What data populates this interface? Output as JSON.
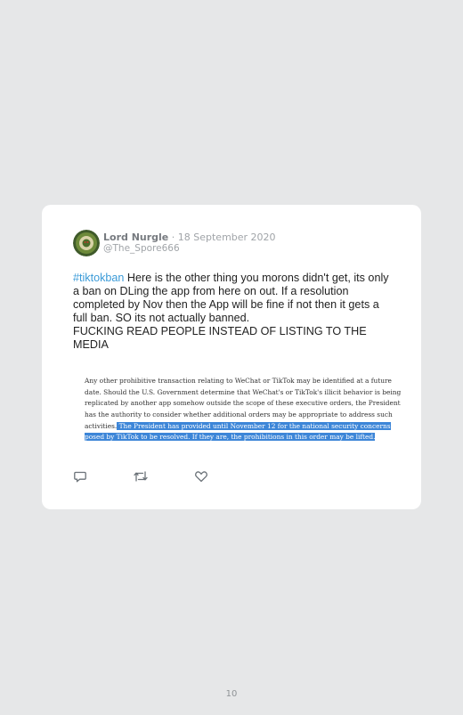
{
  "tweet": {
    "author_name": "Lord Nurgle",
    "separator": " · ",
    "date": "18 September 2020",
    "handle": "@The_Spore666",
    "hashtag": "#tiktokban",
    "body": " Here is the other thing you morons didn't get, its only a ban on DLing the app from here on out. If a resolution completed by Nov then the App will be fine if not then it gets a full ban. SO its not actually banned.\nFUCKING READ PEOPLE INSTEAD OF LISTING TO THE MEDIA"
  },
  "quoted_image": {
    "lines": [
      "Any other prohibitive transaction relating to WeChat or TikTok may be identified at a future",
      "date. Should the U.S. Government determine that WeChat's or TikTok's illicit behavior is being",
      "replicated by another app somehow outside the scope of these executive orders, the President",
      "has the authority to consider whether additional orders may be appropriate to address such"
    ],
    "line5_plain": "activities.",
    "line5_highlight": " The President has provided until November 12 for the national security concerns",
    "line6_highlight": "posed by TikTok to be resolved. If they are, the prohibitions in this order may be lifted."
  },
  "actions": {
    "reply_icon": "reply-icon",
    "retweet_icon": "retweet-icon",
    "like_icon": "heart-icon"
  },
  "page_number": "10"
}
